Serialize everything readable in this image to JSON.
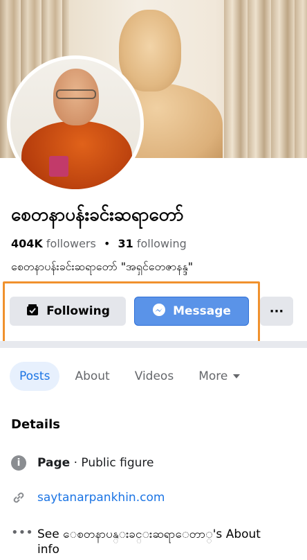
{
  "profile": {
    "name": "စေတနာပန်းခင်းဆရာတော်",
    "followers_count": "404K",
    "followers_label": "followers",
    "separator": "•",
    "following_count": "31",
    "following_label": "following",
    "intro": "စေတနာပန်းခင်းဆရာတော် \"အရှင်တေဇာနန္ဒ\""
  },
  "actions": {
    "following_label": "Following",
    "message_label": "Message",
    "more_label": "···",
    "highlight_color": "#f0912d"
  },
  "tabs": [
    {
      "label": "Posts",
      "active": true
    },
    {
      "label": "About",
      "active": false
    },
    {
      "label": "Videos",
      "active": false
    },
    {
      "label": "More",
      "active": false
    }
  ],
  "details": {
    "title": "Details",
    "category_label": "Page",
    "category_value": "· Public figure",
    "website": "saytanarpankhin.com",
    "about_text": "See ေစတနာပန္းခင္းဆရာေတာ္'s About info"
  },
  "colors": {
    "accent": "#1b74e4",
    "message_button": "#5a93e8"
  },
  "icons": {
    "following": "inbox-check-icon",
    "message": "messenger-icon",
    "info": "info-icon",
    "link": "link-icon",
    "more": "dots-icon"
  }
}
